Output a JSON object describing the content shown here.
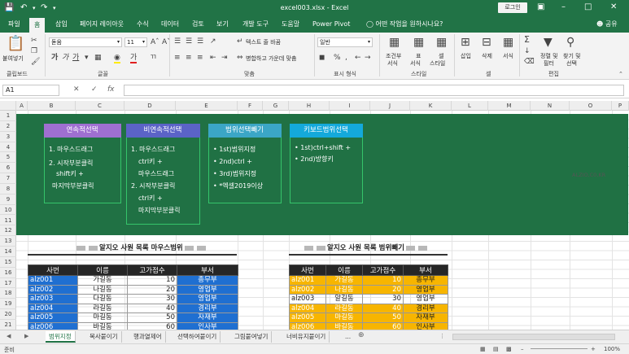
{
  "window": {
    "title": "excel003.xlsx - Excel",
    "login_label": "로그인"
  },
  "ribbon_tabs": [
    "파일",
    "홈",
    "삽입",
    "페이지 레이아웃",
    "수식",
    "데이터",
    "검토",
    "보기",
    "개발 도구",
    "도움말",
    "Power Pivot"
  ],
  "tell_me": "어떤 작업을 원하시나요?",
  "share": "공유",
  "ribbon": {
    "paste": "붙여넣기",
    "font_name": "돋움",
    "font_size": "11",
    "wrap_text": "텍스트 줄 바꿈",
    "merge_center": "병합하고 가운데 맞춤",
    "number_format": "일반",
    "conditional": "조건부",
    "conditional2": "서식",
    "table_format": "표",
    "table_format2": "서식",
    "cell_style": "셀",
    "cell_style2": "스타일",
    "insert": "삽입",
    "delete": "삭제",
    "format": "서식",
    "sort_filter": "정렬 및",
    "sort_filter2": "필터",
    "find_select": "찾기 및",
    "find_select2": "선택",
    "groups": [
      "클립보드",
      "글꼴",
      "맞춤",
      "표시 형식",
      "스타일",
      "셀",
      "편집"
    ],
    "percent": "%",
    "comma": ","
  },
  "formula_bar": {
    "name_box": "A1",
    "fx": "fx",
    "value": ""
  },
  "columns": [
    "A",
    "B",
    "C",
    "D",
    "E",
    "F",
    "G",
    "H",
    "I",
    "J",
    "K",
    "L",
    "M",
    "N",
    "O",
    "P"
  ],
  "rows": [
    "1",
    "2",
    "3",
    "4",
    "5",
    "6",
    "7",
    "8",
    "9",
    "10",
    "11",
    "12",
    "13",
    "14",
    "15",
    "16",
    "17",
    "18",
    "19",
    "20",
    "21"
  ],
  "cards": [
    {
      "title": "연속적선택",
      "header_color": "#9f6fd1",
      "lines": [
        "1. 마우스드래그",
        "2. 시작부분클릭",
        "shift키 +",
        "마지막부분클릭"
      ]
    },
    {
      "title": "비연속적선택",
      "header_color": "#5b63c7",
      "lines": [
        "1. 마우스드래그",
        "ctrl키 +",
        "마우스드래그",
        "2. 시작부분클릭",
        "ctrl키 +",
        "마지막부분클릭"
      ]
    },
    {
      "title": "범위선택빼기",
      "header_color": "#3ba6c6",
      "lines": [
        "• 1st)범위지정",
        "• 2nd)ctrl +",
        "• 3rd)범위지정",
        "• *엑셀2019이상"
      ]
    },
    {
      "title": "키보드범위선택",
      "header_color": "#14a9db",
      "lines": [
        "• 1st)ctrl+shift +",
        "• 2nd)방향키"
      ]
    }
  ],
  "side_note": "ALZIO,C0,KR",
  "left_table": {
    "title": "알지오 사원 목록 마우스범위",
    "headers": [
      "사번",
      "이름",
      "고가점수",
      "부서"
    ],
    "rows": [
      [
        "alz001",
        "가길동",
        "10",
        "총무부"
      ],
      [
        "alz002",
        "나길동",
        "20",
        "영업부"
      ],
      [
        "alz003",
        "다길동",
        "30",
        "영업부"
      ],
      [
        "alz004",
        "라길동",
        "40",
        "경리부"
      ],
      [
        "alz005",
        "마길동",
        "50",
        "자재부"
      ],
      [
        "alz006",
        "바길동",
        "60",
        "인사부"
      ]
    ]
  },
  "right_table": {
    "title": "알지오 사원 목록 범위빼기",
    "headers": [
      "사번",
      "이름",
      "고가점수",
      "부서"
    ],
    "rows": [
      [
        "alz001",
        "가길동",
        "10",
        "총무부"
      ],
      [
        "alz002",
        "나길동",
        "20",
        "영업부"
      ],
      [
        "alz003",
        "알길동",
        "30",
        "영업부"
      ],
      [
        "alz004",
        "라길동",
        "40",
        "경리부"
      ],
      [
        "alz005",
        "마길동",
        "50",
        "자재부"
      ],
      [
        "alz006",
        "바길동",
        "60",
        "인사부"
      ]
    ]
  },
  "colors": {
    "excel_green": "#217346",
    "sheet_green": "#207144",
    "selection_blue": "#1f6fd1",
    "selection_yellow": "#f7b500"
  },
  "sheet_tabs": [
    "범위지정",
    "복사붙이기",
    "행과열제어",
    "선택하여붙이기",
    "그림붙여넣기",
    "너비유지붙이기",
    "..."
  ],
  "status": {
    "ready": "준비",
    "zoom": "100%"
  }
}
